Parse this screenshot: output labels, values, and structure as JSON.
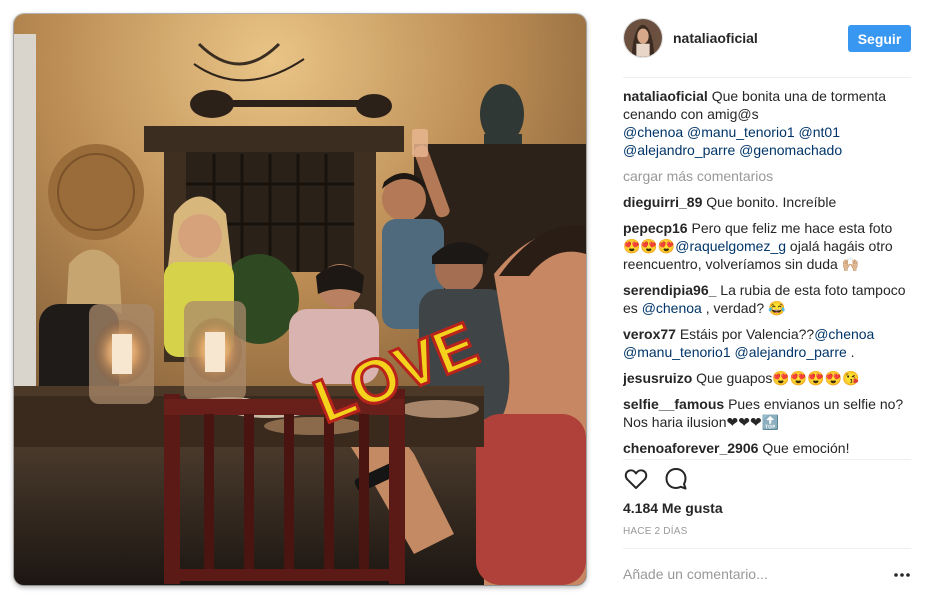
{
  "post": {
    "username": "nataliaoficial",
    "follow_label": "Seguir",
    "photo_sticker": "LOVE",
    "caption": {
      "user": "nataliaoficial",
      "text": "Que bonita una de tormenta cenando con amig@s",
      "mentions_line1": "@chenoa @manu_tenorio1 @nt01",
      "mentions_line2": "@alejandro_parre @genomachado"
    },
    "load_more": "cargar más comentarios",
    "comments": [
      {
        "user": "dieguirri_89",
        "text": "Que bonito. Increíble"
      },
      {
        "user": "pepecp16",
        "text_a": "Pero que feliz me hace esta foto",
        "emoji": "😍😍😍",
        "mention": "@raquelgomez_g",
        "text_b": "ojalá hagáis otro reencuentro, volveríamos sin duda 🙌🏼"
      },
      {
        "user": "serendipia96_",
        "text_a": "La rubia de esta foto tampoco es",
        "mention": "@chenoa",
        "text_b": ", verdad? 😂"
      },
      {
        "user": "verox77",
        "text_a": "Estáis por Valencia??",
        "mention": "@chenoa @manu_tenorio1 @alejandro_parre",
        "text_b": "."
      },
      {
        "user": "jesusruizo",
        "text": "Que guapos😍😍😍😍😘"
      },
      {
        "user": "selfie__famous",
        "text": "Pues envianos un selfie no? Nos haria ilusion❤❤❤🔝"
      },
      {
        "user": "chenoaforever_2906",
        "text": "Que emoción! Pasaroslo muy bien! ❤❤❤😍"
      }
    ],
    "likes": "4.184 Me gusta",
    "date": "HACE 2 DÍAS",
    "comment_placeholder": "Añade un comentario..."
  }
}
